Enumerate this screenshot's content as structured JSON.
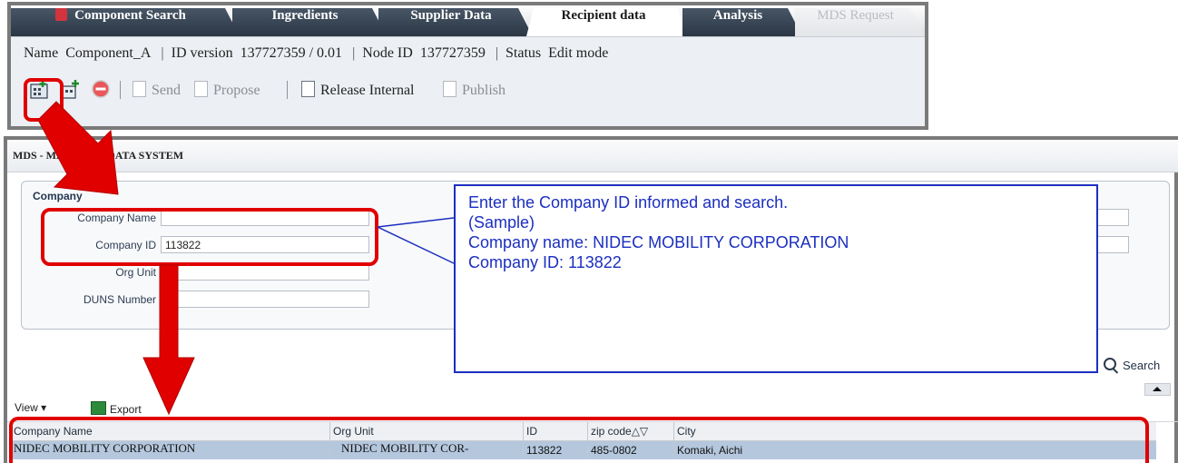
{
  "top_window": {
    "tabs": [
      {
        "label": "Component Search",
        "state": "normal",
        "icon": "cube-icon"
      },
      {
        "label": "Ingredients",
        "state": "normal"
      },
      {
        "label": "Supplier Data",
        "state": "normal"
      },
      {
        "label": "Recipient data",
        "state": "active"
      },
      {
        "label": "Analysis",
        "state": "normal"
      },
      {
        "label": "MDS Request",
        "state": "disabled"
      }
    ],
    "info": {
      "name_label": "Name",
      "name_value": "Component_A",
      "id_version_label": "ID version",
      "id_version_value": "137727359 / 0.01",
      "node_id_label": "Node ID",
      "node_id_value": "137727359",
      "status_label": "Status",
      "status_value": "Edit mode",
      "separator": "|"
    },
    "toolbar": {
      "send_label": "Send",
      "propose_label": "Propose",
      "release_internal_label": "Release Internal",
      "publish_label": "Publish"
    }
  },
  "mds_window": {
    "title": "MDS - MATERIAL DATA SYSTEM",
    "company_panel": {
      "heading": "Company",
      "fields": {
        "company_name_label": "Company Name",
        "company_name_value": "",
        "company_id_label": "Company ID",
        "company_id_value": "113822",
        "org_unit_label": "Org Unit",
        "org_unit_value": "",
        "duns_label": "DUNS Number",
        "duns_value": ""
      }
    },
    "search_label": "Search",
    "table_toolbar": {
      "view_label": "View ▾",
      "export_label": "Export"
    },
    "grid": {
      "columns": [
        "Company Name",
        "Org Unit",
        "ID",
        "zip code△▽",
        "City"
      ],
      "rows": [
        [
          "NIDEC MOBILITY CORPORATION",
          "NIDEC MOBILITY COR-",
          "113822",
          "485-0802",
          "Komaki, Aichi"
        ]
      ]
    }
  },
  "callout": {
    "line1": "Enter the Company ID informed and search.",
    "line2": "(Sample)",
    "line3": "Company name: NIDEC MOBILITY CORPORATION",
    "line4": "Company ID: 113822"
  },
  "colors": {
    "annotation_red": "#e00000",
    "callout_blue": "#1b2fbf",
    "tab_dark": "#2b3744",
    "selected_row": "#b4c7dd"
  }
}
